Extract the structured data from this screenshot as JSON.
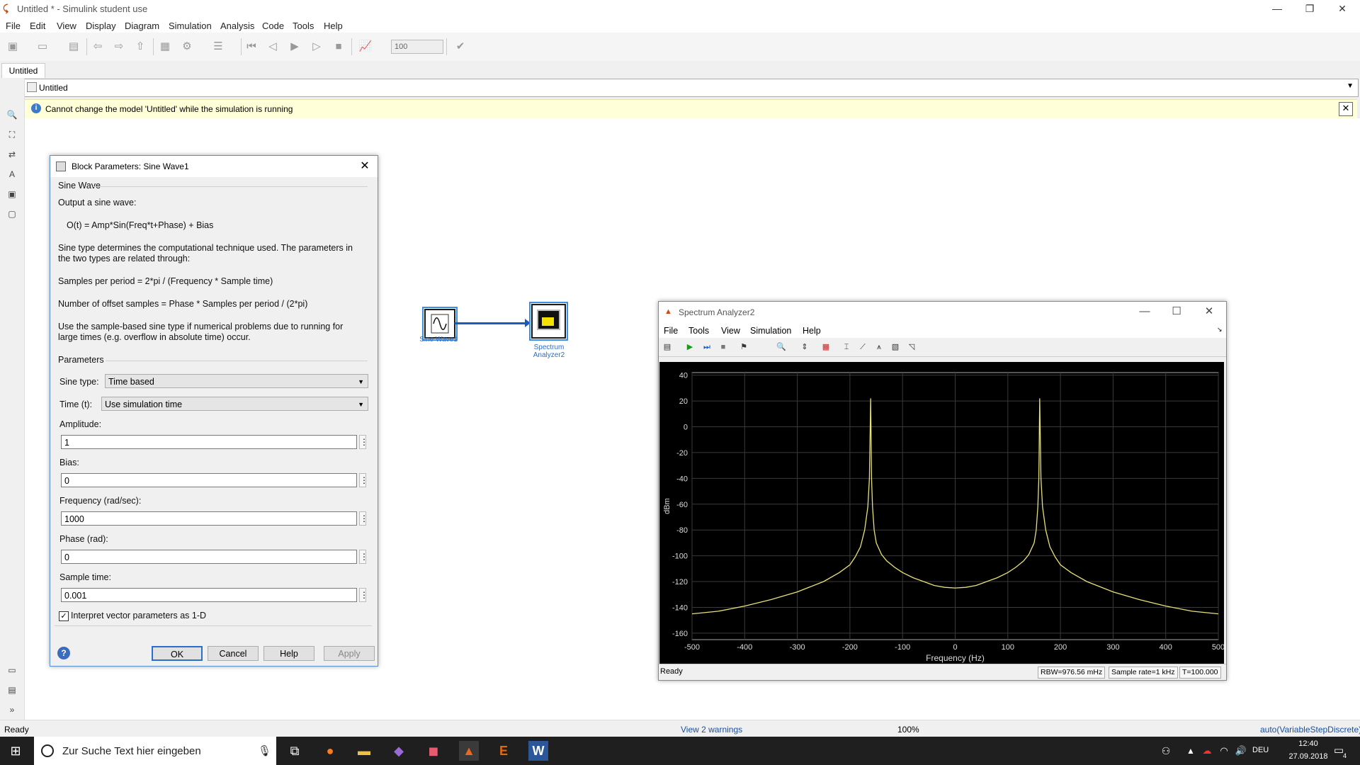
{
  "window": {
    "title": "Untitled * - Simulink student use"
  },
  "menu": [
    "File",
    "Edit",
    "View",
    "Display",
    "Diagram",
    "Simulation",
    "Analysis",
    "Code",
    "Tools",
    "Help"
  ],
  "toolbar": {
    "stop_time": "100"
  },
  "tab": {
    "label": "Untitled"
  },
  "address": {
    "path": "Untitled"
  },
  "info": {
    "message": "Cannot change the model 'Untitled' while the simulation is running"
  },
  "dialog": {
    "title": "Block Parameters: Sine Wave1",
    "group_title": "Sine Wave",
    "description": [
      "Output a sine wave:",
      "O(t) = Amp*Sin(Freq*t+Phase) + Bias",
      "Sine type determines the computational technique used. The parameters in",
      "the two types are related through:",
      "Samples per period = 2*pi / (Frequency * Sample time)",
      "Number of offset samples = Phase * Samples per period / (2*pi)",
      "Use the sample-based sine type if numerical problems due to running for",
      "large times (e.g. overflow in absolute time) occur."
    ],
    "params_title": "Parameters",
    "sine_type_label": "Sine type:",
    "sine_type_value": "Time based",
    "time_label": "Time (t):",
    "time_value": "Use simulation time",
    "fields": [
      {
        "label": "Amplitude:",
        "value": "1"
      },
      {
        "label": "Bias:",
        "value": "0"
      },
      {
        "label": "Frequency (rad/sec):",
        "value": "1000"
      },
      {
        "label": "Phase (rad):",
        "value": "0"
      },
      {
        "label": "Sample time:",
        "value": "0.001"
      }
    ],
    "checkbox_label": "Interpret vector parameters as 1-D",
    "buttons": {
      "ok": "OK",
      "cancel": "Cancel",
      "help": "Help",
      "apply": "Apply"
    }
  },
  "blocks": {
    "sine_label": "Sine Wave1",
    "spectrum_label_1": "Spectrum",
    "spectrum_label_2": "Analyzer2"
  },
  "spectrum": {
    "title": "Spectrum Analyzer2",
    "menu": [
      "File",
      "Tools",
      "View",
      "Simulation",
      "Help"
    ],
    "status": "Ready",
    "rbw": "RBW=976.56 mHz",
    "sample_rate": "Sample rate=1 kHz",
    "time": "T=100.000"
  },
  "chart_data": {
    "type": "line",
    "xlabel": "Frequency (Hz)",
    "ylabel": "dBm",
    "xlim": [
      -500,
      500
    ],
    "ylim": [
      -165,
      42
    ],
    "xticks": [
      -500,
      -400,
      -300,
      -200,
      -100,
      0,
      100,
      200,
      300,
      400,
      500
    ],
    "yticks": [
      40,
      20,
      0,
      -20,
      -40,
      -60,
      -80,
      -100,
      -120,
      -140,
      -160
    ],
    "grid": true,
    "series": [
      {
        "color": "#e8e07a",
        "x": [
          -500,
          -450,
          -400,
          -350,
          -300,
          -250,
          -220,
          -200,
          -190,
          -180,
          -172,
          -166,
          -163,
          -160.5,
          -159,
          -157,
          -154,
          -150,
          -140,
          -130,
          -115,
          -100,
          -80,
          -60,
          -40,
          -20,
          0,
          20,
          40,
          60,
          80,
          100,
          115,
          130,
          140,
          150,
          154,
          157,
          159,
          160.5,
          163,
          166,
          172,
          180,
          190,
          200,
          220,
          250,
          300,
          350,
          400,
          450,
          500
        ],
        "y": [
          -145,
          -143,
          -139,
          -134,
          -128,
          -120,
          -113,
          -107,
          -101,
          -93,
          -80,
          -62,
          -40,
          22,
          -40,
          -62,
          -80,
          -90,
          -99,
          -104,
          -109,
          -113,
          -117,
          -120,
          -123,
          -124.5,
          -125,
          -124.5,
          -123,
          -120,
          -117,
          -113,
          -109,
          -104,
          -99,
          -90,
          -80,
          -62,
          -40,
          22,
          -40,
          -62,
          -80,
          -93,
          -101,
          -107,
          -113,
          -120,
          -128,
          -134,
          -139,
          -143,
          -145
        ]
      }
    ]
  },
  "statusbar": {
    "left": "Ready",
    "warnings": "View 2 warnings",
    "zoom": "100%",
    "solver": "auto(VariableStepDiscrete)"
  },
  "taskbar": {
    "search": "Zur Suche Text hier eingeben",
    "lang": "DEU",
    "time": "12:40",
    "date": "27.09.2018",
    "notif": "4"
  }
}
